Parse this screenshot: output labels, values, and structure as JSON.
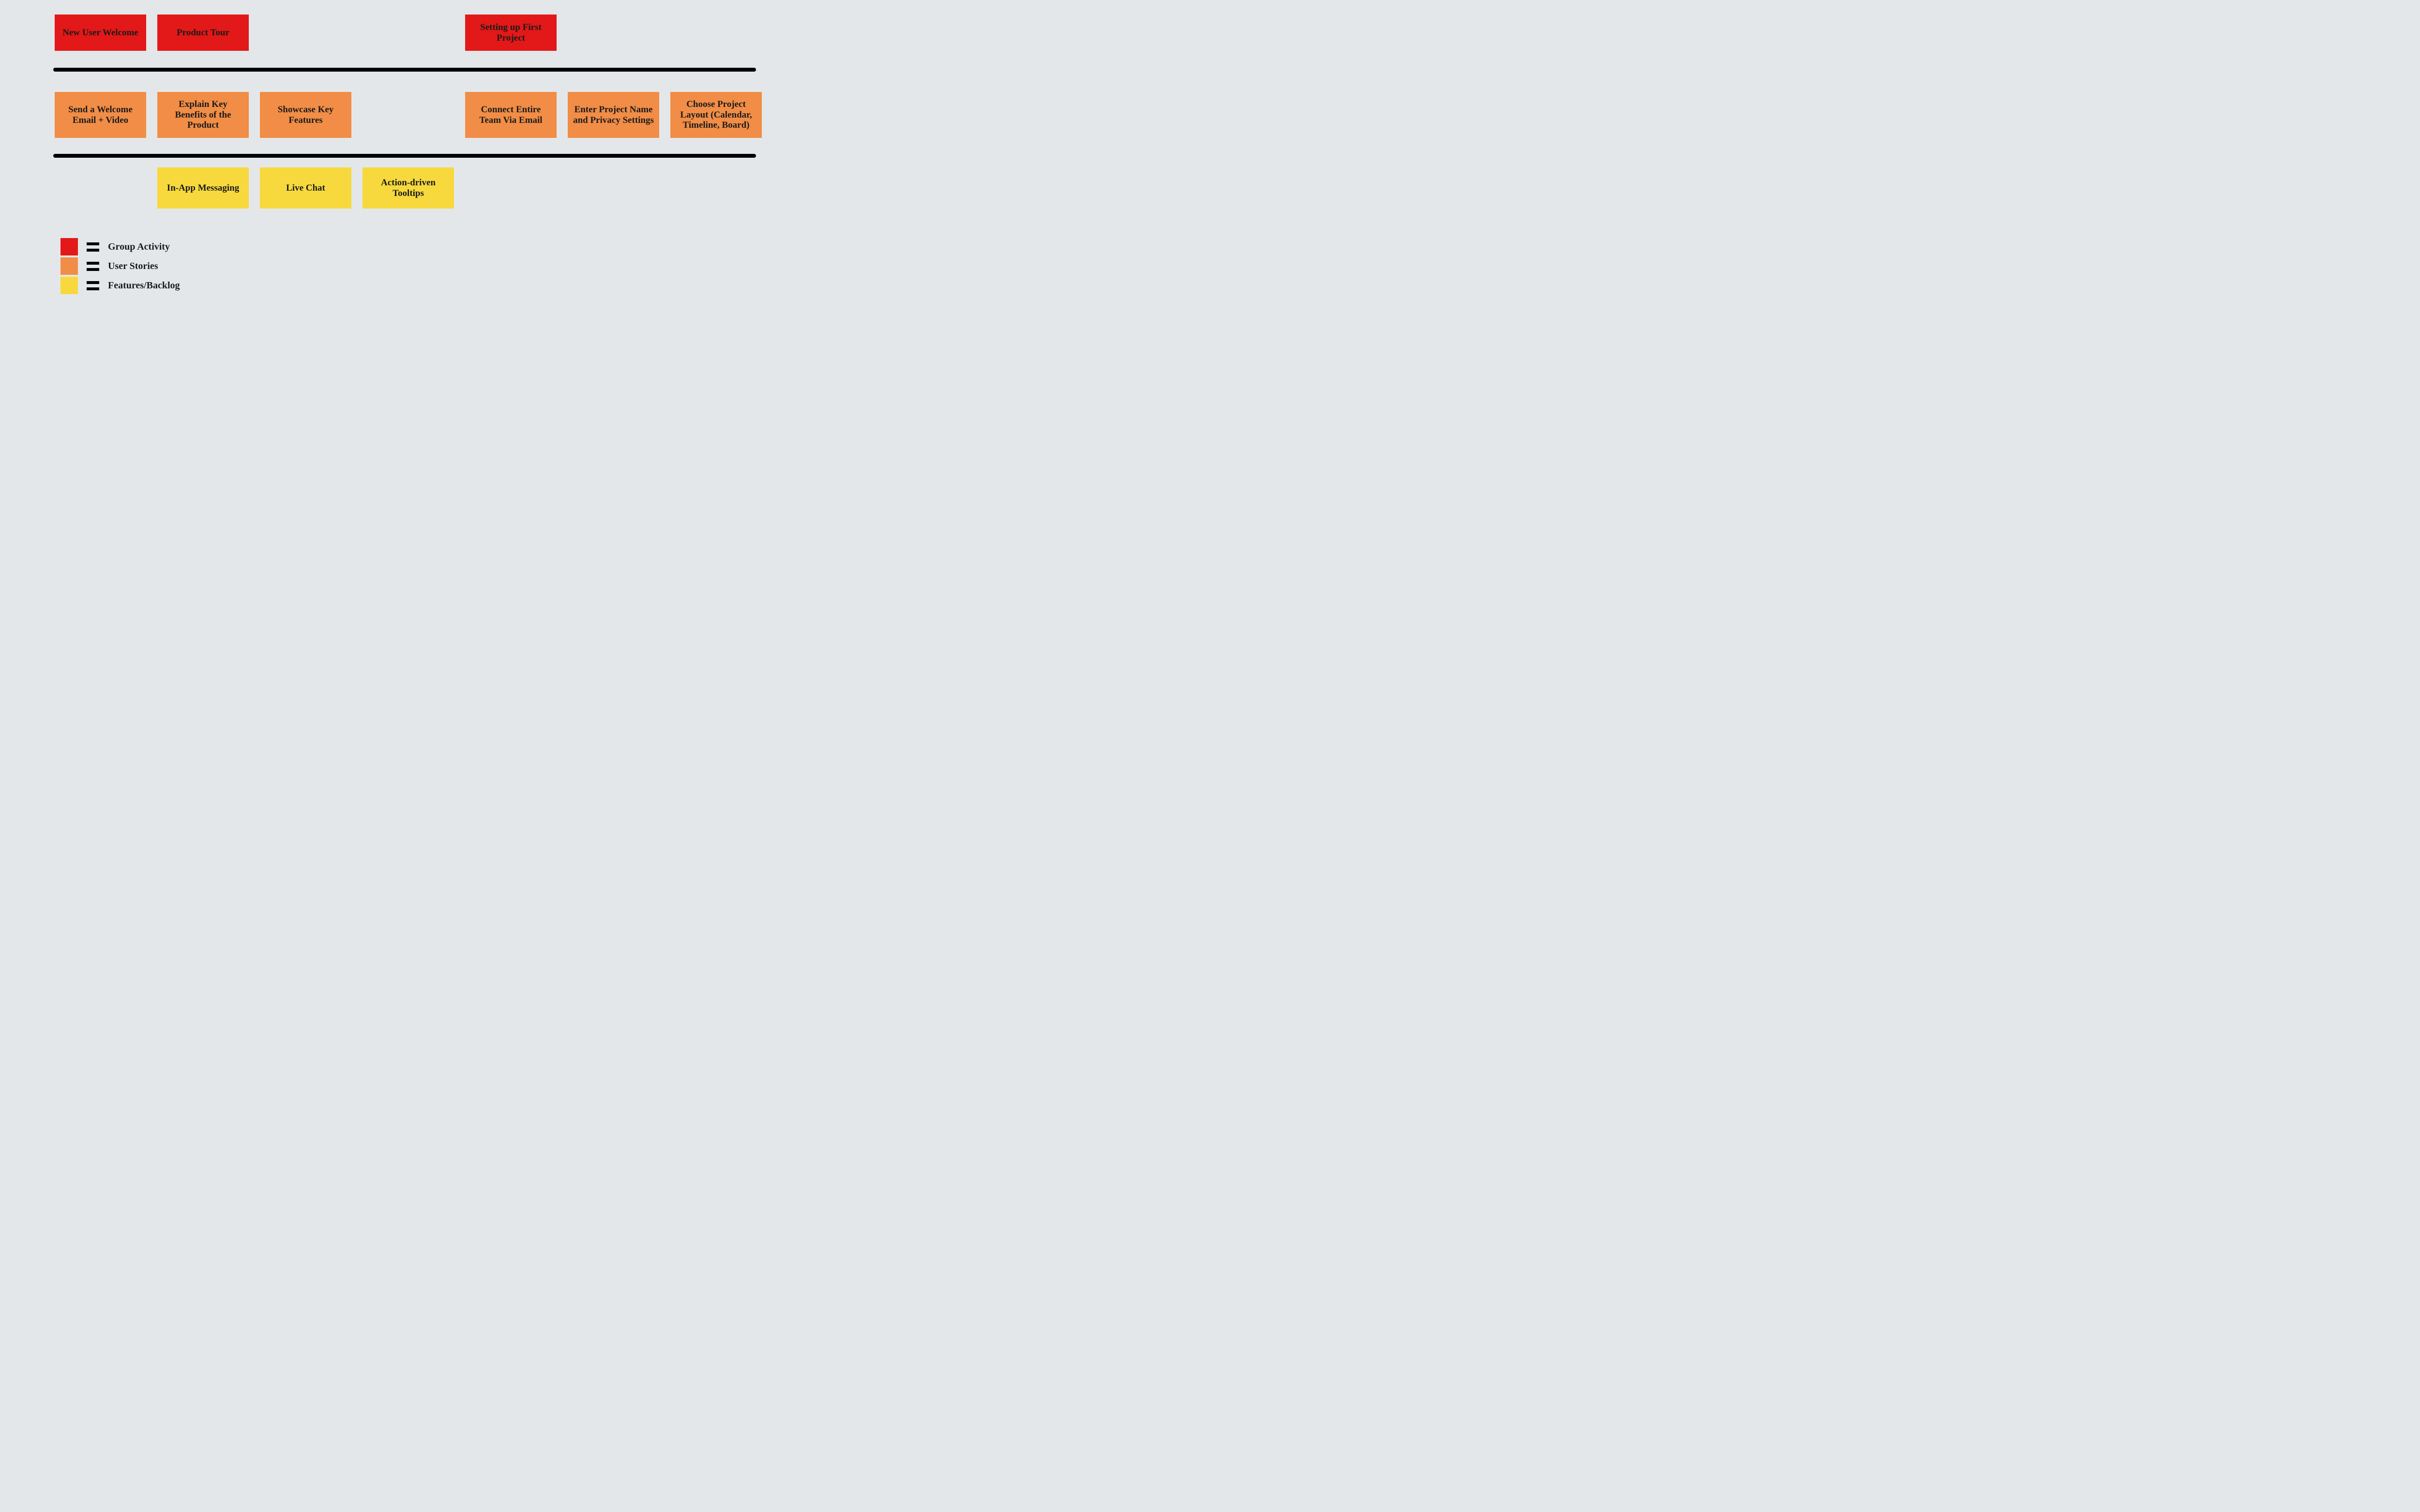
{
  "colors": {
    "group_activity": "#e31818",
    "user_stories": "#f18d46",
    "features": "#f7d93d",
    "rule": "#000000",
    "bg": "#e4e7e9"
  },
  "rows": {
    "group": [
      {
        "label": "New User Welcome",
        "col": 0
      },
      {
        "label": "Product Tour",
        "col": 1
      },
      {
        "label": "Setting up First Project",
        "col": 4
      }
    ],
    "stories": [
      {
        "label": "Send a Welcome Email + Video",
        "col": 0
      },
      {
        "label": "Explain Key Benefits of the Product",
        "col": 1
      },
      {
        "label": "Showcase Key Features",
        "col": 2
      },
      {
        "label": "Connect Entire Team Via Email",
        "col": 4
      },
      {
        "label": "Enter Project Name and Privacy Settings",
        "col": 5
      },
      {
        "label": "Choose Project Layout (Calendar, Timeline, Board)",
        "col": 6
      }
    ],
    "features": [
      {
        "label": "In-App Messaging",
        "col": 1
      },
      {
        "label": "Live Chat",
        "col": 2
      },
      {
        "label": "Action-driven Tooltips",
        "col": 3
      }
    ]
  },
  "legend": {
    "group": "Group Activity",
    "stories": "User Stories",
    "features": "Features/Backlog"
  }
}
